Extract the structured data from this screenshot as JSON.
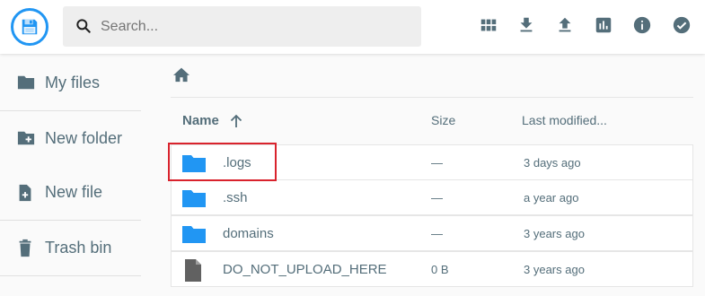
{
  "header": {
    "search_placeholder": "Search...",
    "actions": [
      {
        "icon": "grid-view-icon"
      },
      {
        "icon": "download-icon"
      },
      {
        "icon": "upload-icon"
      },
      {
        "icon": "stats-icon"
      },
      {
        "icon": "info-icon"
      },
      {
        "icon": "check-circle-icon"
      }
    ]
  },
  "sidebar": {
    "items": [
      {
        "label": "My files",
        "icon": "folder-icon"
      },
      {
        "label": "New folder",
        "icon": "create-folder-icon"
      },
      {
        "label": "New file",
        "icon": "note-add-icon"
      },
      {
        "label": "Trash bin",
        "icon": "trash-icon"
      }
    ]
  },
  "listing": {
    "columns": {
      "name": "Name",
      "size": "Size",
      "modified": "Last modified..."
    },
    "files": [
      {
        "name": ".logs",
        "size": "—",
        "modified": "3 days ago",
        "type": "folder"
      },
      {
        "name": ".ssh",
        "size": "—",
        "modified": "a year ago",
        "type": "folder"
      },
      {
        "name": "domains",
        "size": "—",
        "modified": "3 years ago",
        "type": "folder"
      },
      {
        "name": "DO_NOT_UPLOAD_HERE",
        "size": "0 B",
        "modified": "3 years ago",
        "type": "file"
      }
    ]
  },
  "colors": {
    "accent": "#2196f3",
    "folder": "#2196f3",
    "text": "#546e7a",
    "icon": "#546e7a",
    "highlight": "#d9232d"
  }
}
